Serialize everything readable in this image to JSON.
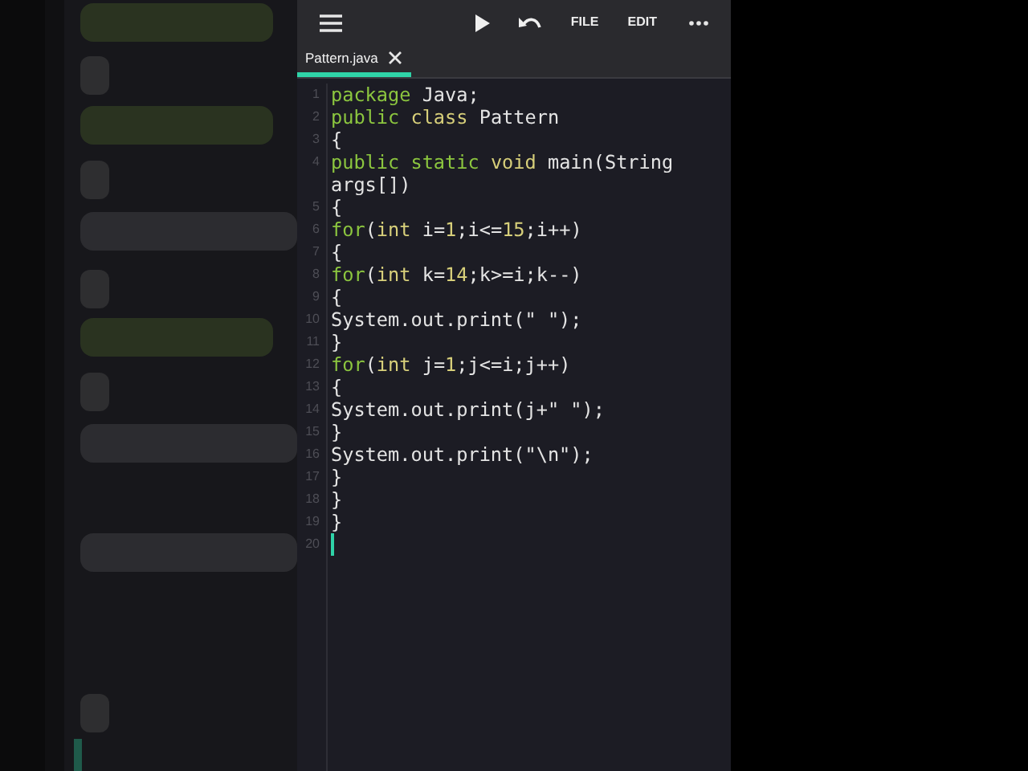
{
  "toolbar": {
    "buttons": [
      {
        "kind": "icon"
      },
      {
        "kind": "icon"
      },
      {
        "kind": "icon"
      },
      {
        "kind": "text",
        "label": "FILE"
      },
      {
        "kind": "text",
        "label": "EDIT"
      },
      {
        "kind": "icon"
      }
    ]
  },
  "tabs": [
    {
      "label": "Pattern.java",
      "selected": true
    }
  ],
  "editor": {
    "lines": [
      {
        "number": "1",
        "cursor": false,
        "tokens": [
          {
            "kind": "keyword",
            "text": "package"
          },
          {
            "kind": "plain",
            "text": " Java;"
          }
        ]
      },
      {
        "number": "2",
        "cursor": false,
        "tokens": [
          {
            "kind": "keyword",
            "text": "public "
          },
          {
            "kind": "type",
            "text": "class"
          },
          {
            "kind": "plain",
            "text": " Pattern"
          }
        ]
      },
      {
        "number": "3",
        "cursor": false,
        "tokens": [
          {
            "kind": "plain",
            "text": "{"
          }
        ]
      },
      {
        "number": "4",
        "cursor": false,
        "tokens": [
          {
            "kind": "keyword",
            "text": "public static "
          },
          {
            "kind": "type",
            "text": "void"
          },
          {
            "kind": "plain",
            "text": " main(String args[])"
          }
        ]
      },
      {
        "number": "5",
        "cursor": false,
        "tokens": [
          {
            "kind": "plain",
            "text": "{"
          }
        ]
      },
      {
        "number": "6",
        "cursor": false,
        "tokens": [
          {
            "kind": "keyword",
            "text": "for"
          },
          {
            "kind": "plain",
            "text": "("
          },
          {
            "kind": "type",
            "text": "int"
          },
          {
            "kind": "plain",
            "text": " i="
          },
          {
            "kind": "number",
            "text": "1"
          },
          {
            "kind": "plain",
            "text": ";i<="
          },
          {
            "kind": "number",
            "text": "15"
          },
          {
            "kind": "plain",
            "text": ";i++)"
          }
        ]
      },
      {
        "number": "7",
        "cursor": false,
        "tokens": [
          {
            "kind": "plain",
            "text": "{"
          }
        ]
      },
      {
        "number": "8",
        "cursor": false,
        "tokens": [
          {
            "kind": "keyword",
            "text": "for"
          },
          {
            "kind": "plain",
            "text": "("
          },
          {
            "kind": "type",
            "text": "int"
          },
          {
            "kind": "plain",
            "text": " k="
          },
          {
            "kind": "number",
            "text": "14"
          },
          {
            "kind": "plain",
            "text": ";k>=i;k--)"
          }
        ]
      },
      {
        "number": "9",
        "cursor": false,
        "tokens": [
          {
            "kind": "plain",
            "text": "{"
          }
        ]
      },
      {
        "number": "10",
        "cursor": false,
        "tokens": [
          {
            "kind": "plain",
            "text": "System.out.print(\" \");"
          }
        ]
      },
      {
        "number": "11",
        "cursor": false,
        "tokens": [
          {
            "kind": "plain",
            "text": "}"
          }
        ]
      },
      {
        "number": "12",
        "cursor": false,
        "tokens": [
          {
            "kind": "keyword",
            "text": "for"
          },
          {
            "kind": "plain",
            "text": "("
          },
          {
            "kind": "type",
            "text": "int"
          },
          {
            "kind": "plain",
            "text": " j="
          },
          {
            "kind": "number",
            "text": "1"
          },
          {
            "kind": "plain",
            "text": ";j<=i;j++)"
          }
        ]
      },
      {
        "number": "13",
        "cursor": false,
        "tokens": [
          {
            "kind": "plain",
            "text": "{"
          }
        ]
      },
      {
        "number": "14",
        "cursor": false,
        "tokens": [
          {
            "kind": "plain",
            "text": "System.out.print(j+\" \");"
          }
        ]
      },
      {
        "number": "15",
        "cursor": false,
        "tokens": [
          {
            "kind": "plain",
            "text": "}"
          }
        ]
      },
      {
        "number": "16",
        "cursor": false,
        "tokens": [
          {
            "kind": "plain",
            "text": "System.out.print(\"\\n\");"
          }
        ]
      },
      {
        "number": "17",
        "cursor": false,
        "tokens": [
          {
            "kind": "plain",
            "text": "}"
          }
        ]
      },
      {
        "number": "18",
        "cursor": false,
        "tokens": [
          {
            "kind": "plain",
            "text": "}"
          }
        ]
      },
      {
        "number": "19",
        "cursor": false,
        "tokens": [
          {
            "kind": "plain",
            "text": "}"
          }
        ]
      },
      {
        "number": "20",
        "cursor": true
      }
    ]
  }
}
